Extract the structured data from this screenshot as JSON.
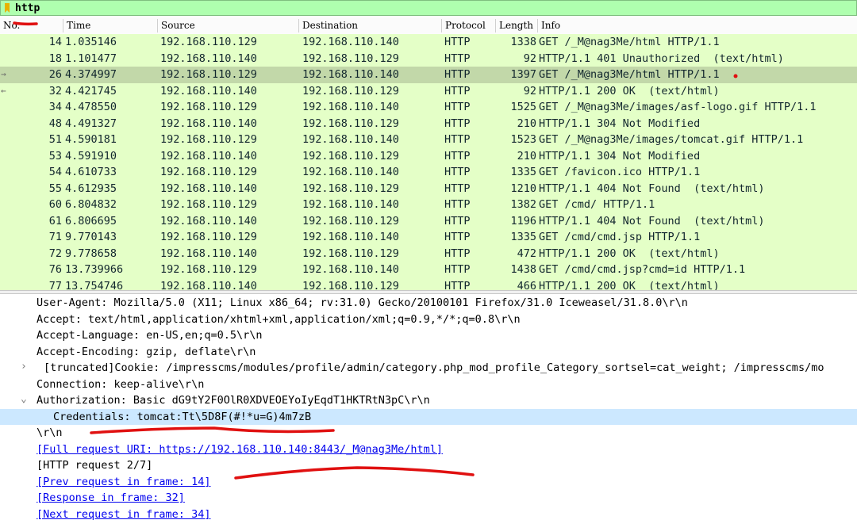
{
  "filter": {
    "value": "http"
  },
  "columns": {
    "no": "No.",
    "time": "Time",
    "source": "Source",
    "destination": "Destination",
    "protocol": "Protocol",
    "length": "Length",
    "info": "Info"
  },
  "packets": [
    {
      "no": "14",
      "time": "1.035146",
      "src": "192.168.110.129",
      "dst": "192.168.110.140",
      "proto": "HTTP",
      "len": "1338",
      "info": "GET /_M@nag3Me/html HTTP/1.1"
    },
    {
      "no": "18",
      "time": "1.101477",
      "src": "192.168.110.140",
      "dst": "192.168.110.129",
      "proto": "HTTP",
      "len": "92",
      "info": "HTTP/1.1 401 Unauthorized  (text/html)"
    },
    {
      "no": "26",
      "time": "4.374997",
      "src": "192.168.110.129",
      "dst": "192.168.110.140",
      "proto": "HTTP",
      "len": "1397",
      "info": "GET /_M@nag3Me/html HTTP/1.1"
    },
    {
      "no": "32",
      "time": "4.421745",
      "src": "192.168.110.140",
      "dst": "192.168.110.129",
      "proto": "HTTP",
      "len": "92",
      "info": "HTTP/1.1 200 OK  (text/html)"
    },
    {
      "no": "34",
      "time": "4.478550",
      "src": "192.168.110.129",
      "dst": "192.168.110.140",
      "proto": "HTTP",
      "len": "1525",
      "info": "GET /_M@nag3Me/images/asf-logo.gif HTTP/1.1"
    },
    {
      "no": "48",
      "time": "4.491327",
      "src": "192.168.110.140",
      "dst": "192.168.110.129",
      "proto": "HTTP",
      "len": "210",
      "info": "HTTP/1.1 304 Not Modified"
    },
    {
      "no": "51",
      "time": "4.590181",
      "src": "192.168.110.129",
      "dst": "192.168.110.140",
      "proto": "HTTP",
      "len": "1523",
      "info": "GET /_M@nag3Me/images/tomcat.gif HTTP/1.1"
    },
    {
      "no": "53",
      "time": "4.591910",
      "src": "192.168.110.140",
      "dst": "192.168.110.129",
      "proto": "HTTP",
      "len": "210",
      "info": "HTTP/1.1 304 Not Modified"
    },
    {
      "no": "54",
      "time": "4.610733",
      "src": "192.168.110.129",
      "dst": "192.168.110.140",
      "proto": "HTTP",
      "len": "1335",
      "info": "GET /favicon.ico HTTP/1.1"
    },
    {
      "no": "55",
      "time": "4.612935",
      "src": "192.168.110.140",
      "dst": "192.168.110.129",
      "proto": "HTTP",
      "len": "1210",
      "info": "HTTP/1.1 404 Not Found  (text/html)"
    },
    {
      "no": "60",
      "time": "6.804832",
      "src": "192.168.110.129",
      "dst": "192.168.110.140",
      "proto": "HTTP",
      "len": "1382",
      "info": "GET /cmd/ HTTP/1.1"
    },
    {
      "no": "61",
      "time": "6.806695",
      "src": "192.168.110.140",
      "dst": "192.168.110.129",
      "proto": "HTTP",
      "len": "1196",
      "info": "HTTP/1.1 404 Not Found  (text/html)"
    },
    {
      "no": "71",
      "time": "9.770143",
      "src": "192.168.110.129",
      "dst": "192.168.110.140",
      "proto": "HTTP",
      "len": "1335",
      "info": "GET /cmd/cmd.jsp HTTP/1.1"
    },
    {
      "no": "72",
      "time": "9.778658",
      "src": "192.168.110.140",
      "dst": "192.168.110.129",
      "proto": "HTTP",
      "len": "472",
      "info": "HTTP/1.1 200 OK  (text/html)"
    },
    {
      "no": "76",
      "time": "13.739966",
      "src": "192.168.110.129",
      "dst": "192.168.110.140",
      "proto": "HTTP",
      "len": "1438",
      "info": "GET /cmd/cmd.jsp?cmd=id HTTP/1.1"
    },
    {
      "no": "77",
      "time": "13.754746",
      "src": "192.168.110.140",
      "dst": "192.168.110.129",
      "proto": "HTTP",
      "len": "466",
      "info": "HTTP/1.1 200 OK  (text/html)"
    }
  ],
  "details": {
    "user_agent": "User-Agent: Mozilla/5.0 (X11; Linux x86_64; rv:31.0) Gecko/20100101 Firefox/31.0 Iceweasel/31.8.0\\r\\n",
    "accept": "Accept: text/html,application/xhtml+xml,application/xml;q=0.9,*/*;q=0.8\\r\\n",
    "accept_language": "Accept-Language: en-US,en;q=0.5\\r\\n",
    "accept_encoding": "Accept-Encoding: gzip, deflate\\r\\n",
    "cookie": "[truncated]Cookie: /impresscms/modules/profile/admin/category.php_mod_profile_Category_sortsel=cat_weight; /impresscms/mo",
    "connection": "Connection: keep-alive\\r\\n",
    "authorization": "Authorization: Basic dG9tY2F0OlR0XDVEOEYoIyEqdT1HKTRtN3pC\\r\\n",
    "credentials": "Credentials: tomcat:Tt\\5D8F(#!*u=G)4m7zB",
    "crlf": "\\r\\n",
    "full_uri": "[Full request URI: https://192.168.110.140:8443/_M@nag3Me/html]",
    "http_request": "[HTTP request 2/7]",
    "prev_request": "[Prev request in frame: 14]",
    "response": "[Response in frame: 32]",
    "next_request": "[Next request in frame: 34]"
  },
  "colors": {
    "filter_bg": "#afffaf",
    "row_bg": "#e4ffc7",
    "row_selected": "#c2d8a9",
    "detail_selected": "#cce8ff",
    "annotation": "#e01010"
  }
}
